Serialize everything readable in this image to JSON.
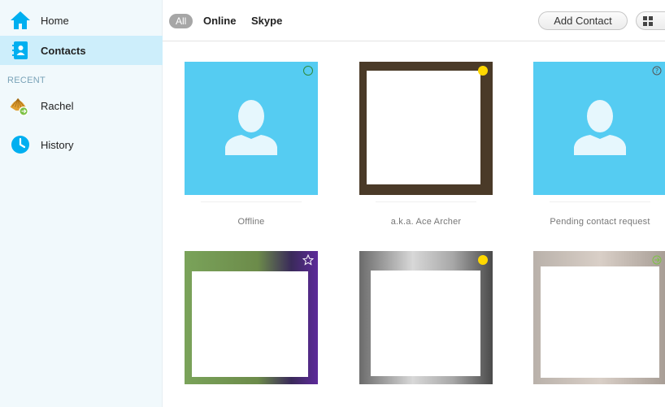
{
  "sidebar": {
    "home_label": "Home",
    "contacts_label": "Contacts",
    "recent_heading": "RECENT",
    "recent_items": [
      {
        "label": "Rachel"
      },
      {
        "label": "History"
      }
    ]
  },
  "toolbar": {
    "filters": [
      "All",
      "Online",
      "Skype"
    ],
    "selected_filter": "All",
    "add_contact_label": "Add Contact",
    "view_icon": "grid-icon"
  },
  "contacts": [
    {
      "caption": "Offline",
      "avatar": "default",
      "status": "online-ring"
    },
    {
      "caption": "a.k.a. Ace Archer",
      "avatar": "photo",
      "status": "away"
    },
    {
      "caption": "Pending contact request",
      "avatar": "default",
      "status": "pending"
    },
    {
      "caption": "",
      "avatar": "photo",
      "status": "favorite"
    },
    {
      "caption": "",
      "avatar": "photo",
      "status": "away"
    },
    {
      "caption": "",
      "avatar": "photo",
      "status": "online-arrow"
    }
  ],
  "colors": {
    "accent": "#00aff0",
    "avatar_bg": "#55ccf2",
    "away": "#ffd800",
    "online": "#7cc244"
  }
}
